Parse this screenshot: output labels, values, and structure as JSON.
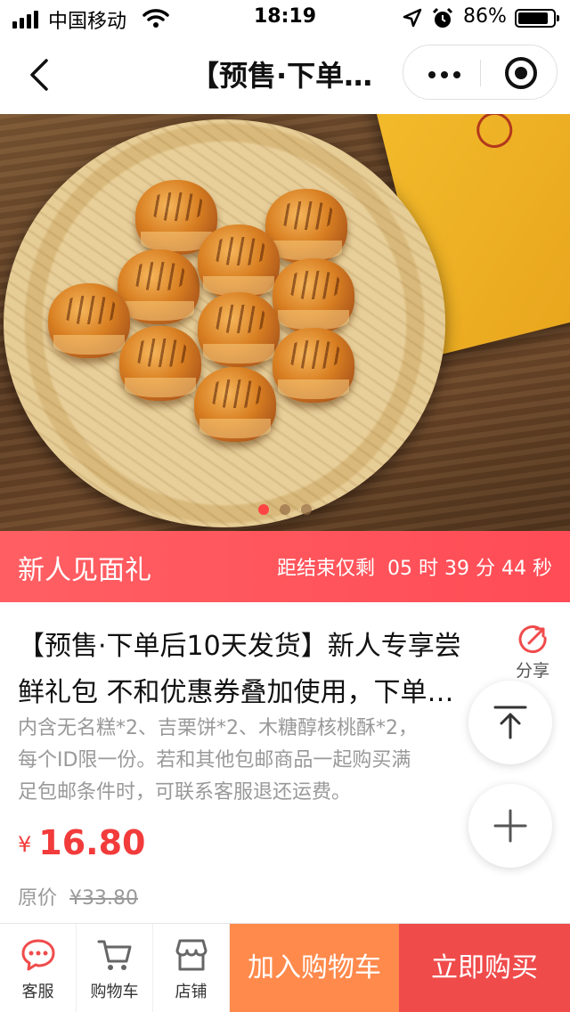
{
  "status_bar": {
    "carrier": "中国移动",
    "time": "18:19",
    "battery_percent": "86%",
    "battery_level": 0.86,
    "icons": [
      "signal-icon",
      "wifi-icon",
      "location-icon",
      "alarm-icon",
      "battery-icon"
    ]
  },
  "nav": {
    "title": "【预售·下单…",
    "icons": [
      "back-icon",
      "more-icon",
      "capsule-close-icon"
    ]
  },
  "hero": {
    "carousel_count": 3,
    "carousel_active": 1
  },
  "promo": {
    "title": "新人见面礼",
    "countdown_prefix": "距结束仅剩",
    "hours": "05",
    "hours_unit": "时",
    "minutes": "39",
    "minutes_unit": "分",
    "seconds": "44",
    "seconds_unit": "秒"
  },
  "product": {
    "title_line1": "【预售·下单后10天发货】新人专享尝",
    "title_line2": "鲜礼包 不和优惠券叠加使用，下单…",
    "share_label": "分享",
    "desc_line1": "内含无名糕*2、吉栗饼*2、木糖醇核桃酥*2，",
    "desc_line2": "每个ID限一份。若和其他包邮商品一起购买满",
    "desc_line3": "足包邮条件时，可联系客服退还运费。",
    "currency": "¥",
    "price": "16.80",
    "original_label": "原价",
    "original_price": "¥33.80"
  },
  "bottom_bar": {
    "service_label": "客服",
    "cart_label": "购物车",
    "shop_label": "店铺",
    "add_to_cart": "加入购物车",
    "buy_now": "立即购买"
  },
  "colors": {
    "promo_bg": "#ff5f63",
    "price": "#f23b3b",
    "add_to_cart_bg": "#ff8a4c",
    "buy_now_bg": "#f04b4b",
    "icon_red": "#f04b4b"
  }
}
